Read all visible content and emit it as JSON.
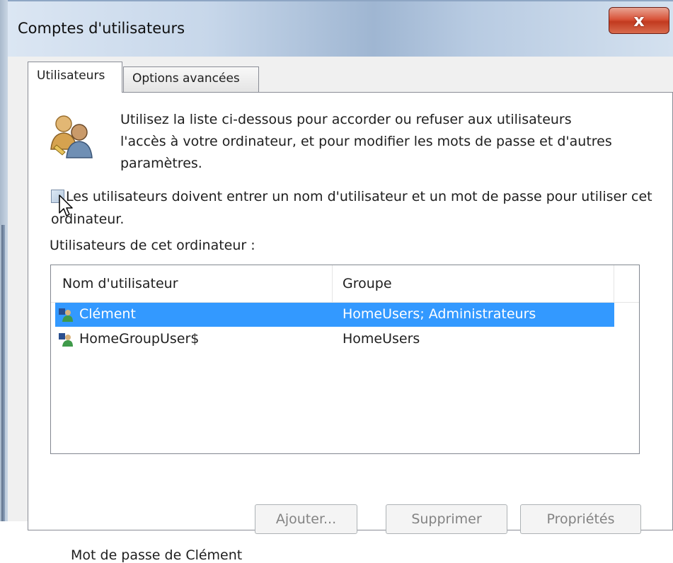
{
  "window": {
    "title": "Comptes d'utilisateurs",
    "close_label": "x"
  },
  "tabs": [
    {
      "label": "Utilisateurs",
      "active": true
    },
    {
      "label": "Options avancées",
      "active": false
    }
  ],
  "intro": {
    "icon": "users-icon",
    "text": "Utilisez la liste ci-dessous pour accorder ou refuser aux utilisateurs l'accès à votre ordinateur, et pour modifier les mots de passe et d'autres paramètres."
  },
  "require_login": {
    "label": "Les utilisateurs doivent entrer un nom d'utilisateur et un mot de passe pour utiliser cet ordinateur.",
    "checked": false
  },
  "users_list": {
    "caption": "Utilisateurs de cet ordinateur :",
    "columns": [
      "Nom d'utilisateur",
      "Groupe"
    ],
    "rows": [
      {
        "name": "Clément",
        "group": "HomeUsers; Administrateurs",
        "selected": true
      },
      {
        "name": "HomeGroupUser$",
        "group": "HomeUsers",
        "selected": false
      }
    ]
  },
  "buttons": {
    "add": "Ajouter...",
    "remove": "Supprimer",
    "properties": "Propriétés"
  },
  "password_section": {
    "label": "Mot de passe de Clément"
  },
  "colors": {
    "selection": "#3399ff",
    "close_button": "#c9442a"
  }
}
